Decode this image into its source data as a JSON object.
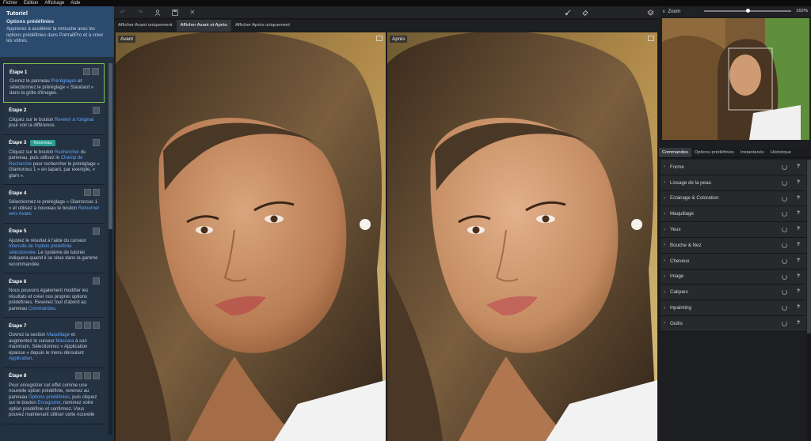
{
  "menu": [
    "Fichier",
    "Édition",
    "Affichage",
    "Aide"
  ],
  "tutorial": {
    "title": "Tutoriel",
    "subtitle": "Options prédéfinies",
    "description": "Apprenez à accélérer la retouche avec les options prédéfinies dans PortraitPro et à créer les vôtres.",
    "steps": [
      {
        "label": "Étape 1",
        "parts": [
          [
            "Ouvrez le panneau ",
            ""
          ],
          [
            "Préréglages",
            "link"
          ],
          [
            " et sélectionnez le préréglage « Standard » dans la grille d'images.",
            ""
          ]
        ]
      },
      {
        "label": "Étape 2",
        "parts": [
          [
            "Cliquez sur le bouton ",
            ""
          ],
          [
            "Revenir à l'original",
            "link"
          ],
          [
            " pour voir la différence.",
            ""
          ]
        ]
      },
      {
        "label": "Étape 3",
        "badge": "Nouveau",
        "parts": [
          [
            "Cliquez sur le bouton ",
            ""
          ],
          [
            "Rechercher",
            "link"
          ],
          [
            " du panneau, puis utilisez le ",
            ""
          ],
          [
            "Champ de Recherche",
            "link"
          ],
          [
            " pour rechercher le préréglage « Glamorous 1 » en tapant, par exemple, « glam ».",
            ""
          ]
        ]
      },
      {
        "label": "Étape 4",
        "parts": [
          [
            "Sélectionnez le préréglage « Glamorous 1 » et utilisez à nouveau le bouton ",
            ""
          ],
          [
            "Retourner vers Avant",
            "link"
          ],
          [
            ".",
            ""
          ]
        ]
      },
      {
        "label": "Étape 5",
        "parts": [
          [
            "Ajustez le résultat à l'aide du curseur ",
            ""
          ],
          [
            "Intensité de l'option prédéfinie sélectionnée",
            "link"
          ],
          [
            ". Le système de tutoriel indiquera quand il se situe dans la gamme recommandée.",
            ""
          ]
        ]
      },
      {
        "label": "Étape 6",
        "parts": [
          [
            "Nous pouvons également modifier les résultats et créer nos propres options prédéfinies. Revenez tout d'abord au panneau ",
            ""
          ],
          [
            "Commandes",
            "link"
          ],
          [
            ".",
            ""
          ]
        ]
      },
      {
        "label": "Étape 7",
        "parts": [
          [
            "Ouvrez la section ",
            ""
          ],
          [
            "Maquillage",
            "link"
          ],
          [
            " et augmentez le curseur ",
            ""
          ],
          [
            "Mascara",
            "link"
          ],
          [
            " à son maximum. Sélectionnez « Application épaisse » depuis le menu déroulant ",
            ""
          ],
          [
            "Application",
            "link"
          ],
          [
            ".",
            ""
          ]
        ]
      },
      {
        "label": "Étape 8",
        "parts": [
          [
            "Pour enregistrer cet effet comme une nouvelle option prédéfinie, revenez au panneau ",
            ""
          ],
          [
            "Options prédéfinies",
            "link"
          ],
          [
            ", puis cliquez sur le bouton ",
            ""
          ],
          [
            "Enregistrer",
            "link"
          ],
          [
            ", nommez votre option prédéfinie et confirmez. Vous pouvez maintenant utiliser cette nouvelle",
            ""
          ]
        ]
      }
    ]
  },
  "view_tabs": [
    "Afficher Avant uniquement",
    "Afficher Avant et Après",
    "Afficher Après uniquement"
  ],
  "panes": {
    "before_label": "Avant",
    "after_label": "Après"
  },
  "zoom": {
    "label": "Zoom",
    "value_text": "162%",
    "level_fraction": 0.5
  },
  "control_tabs": [
    "Commandes",
    "Options prédéfinies",
    "Instantanés",
    "Historique"
  ],
  "commands": [
    "Forme",
    "Lissage de la peau",
    "Eclairage & Coloration",
    "Maquillage",
    "Yeux",
    "Bouche & Nez",
    "Cheveux",
    "Image",
    "Calques",
    "Inpainting",
    "Outils"
  ],
  "colors": {
    "accent_link": "#63a6ff",
    "active_step_border": "#7fc24a",
    "badge": "#2b9c8e"
  }
}
